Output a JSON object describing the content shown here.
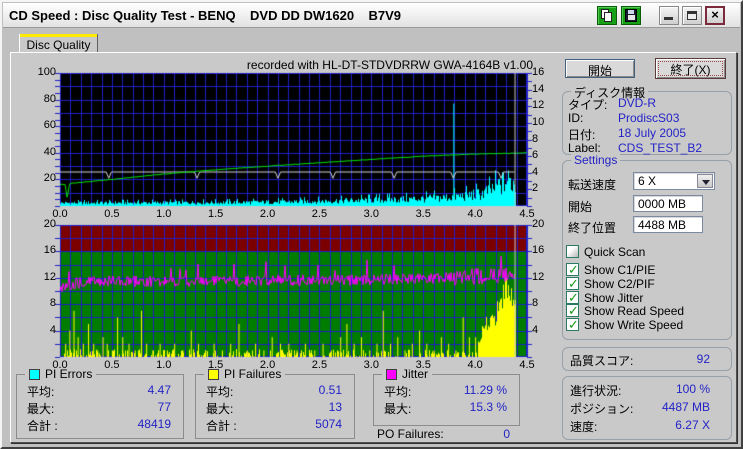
{
  "window": {
    "title": "CD Speed : Disc Quality Test - BENQ    DVD DD DW1620    B7V9"
  },
  "tab": {
    "label": "Disc Quality"
  },
  "buttons": {
    "start": "開始",
    "stop": "終了(X)"
  },
  "disc_info": {
    "group_label": "ディスク情報",
    "rows": [
      {
        "label": "タイプ:",
        "value": "DVD-R"
      },
      {
        "label": "ID:",
        "value": "ProdiscS03"
      },
      {
        "label": "日付:",
        "value": "18 July 2005"
      },
      {
        "label": "Label:",
        "value": "CDS_TEST_B2"
      }
    ]
  },
  "settings": {
    "group_label": "Settings",
    "speed_label": "転送速度",
    "speed_value": "6 X",
    "start_label": "開始",
    "start_value": "0000 MB",
    "end_label": "終了位置",
    "end_value": "4488 MB",
    "checkboxes": [
      {
        "label": "Quick Scan",
        "checked": false
      },
      {
        "label": "Show C1/PIE",
        "checked": true
      },
      {
        "label": "Show C2/PIF",
        "checked": true
      },
      {
        "label": "Show Jitter",
        "checked": true
      },
      {
        "label": "Show Read Speed",
        "checked": true
      },
      {
        "label": "Show Write Speed",
        "checked": true
      }
    ]
  },
  "quality": {
    "label": "品質スコア:",
    "value": "92"
  },
  "progress": {
    "rows": [
      {
        "label": "進行状況:",
        "value": "100 %"
      },
      {
        "label": "ポジション:",
        "value": "4487 MB"
      },
      {
        "label": "速度:",
        "value": "6.27 X"
      }
    ]
  },
  "stats": {
    "pi_errors": {
      "title": "PI Errors",
      "swatch": "#00ffff",
      "rows": [
        {
          "label": "平均:",
          "value": "4.47"
        },
        {
          "label": "最大:",
          "value": "77"
        },
        {
          "label": "合計 :",
          "value": "48419"
        }
      ]
    },
    "pi_failures": {
      "title": "PI Failures",
      "swatch": "#ffff00",
      "rows": [
        {
          "label": "平均:",
          "value": "0.51"
        },
        {
          "label": "最大:",
          "value": "13"
        },
        {
          "label": "合計 :",
          "value": "5074"
        }
      ]
    },
    "jitter": {
      "title": "Jitter",
      "swatch": "#ff00ff",
      "rows": [
        {
          "label": "平均:",
          "value": "11.29 %"
        },
        {
          "label": "最大:",
          "value": "15.3 %"
        }
      ]
    },
    "po_failures": {
      "label": "PO Failures:",
      "value": "0"
    }
  },
  "chart_data": [
    {
      "type": "area",
      "title": "recorded with HL-DT-STDVDRRW GWA-4164B v1.00",
      "x_range": [
        0,
        4.5
      ],
      "x_labels": [
        "0.0",
        "0.5",
        "1.0",
        "1.5",
        "2.0",
        "2.5",
        "3.0",
        "3.5",
        "4.0",
        "4.5"
      ],
      "y_left": {
        "range": [
          0,
          100
        ],
        "ticks": [
          100,
          80,
          60,
          40,
          20
        ],
        "grid_step": 10,
        "tick_step": 5
      },
      "y_right": {
        "range": [
          0,
          16
        ],
        "ticks": [
          16,
          14,
          12,
          10,
          8,
          6,
          4,
          2
        ],
        "tick_step": 1
      },
      "grid_x_step": 0.1,
      "background": "#000000",
      "grid_color": "#1f1fc8",
      "data_end_x": 4.38,
      "series": [
        {
          "name": "PI Errors",
          "type": "noise-bars",
          "axis": "left",
          "color": "#00ffff",
          "envelope_x": [
            0,
            0.3,
            0.8,
            1.3,
            1.8,
            2.2,
            2.6,
            3.0,
            3.4,
            3.7,
            3.9,
            4.05,
            4.15,
            4.25,
            4.32,
            4.38
          ],
          "envelope_y": [
            3.2,
            3.4,
            3.5,
            3.7,
            4.0,
            4.5,
            5.5,
            6.5,
            7.5,
            9,
            11,
            13,
            17,
            24,
            27,
            24
          ],
          "spike": {
            "x": 3.79,
            "y": 77
          },
          "stats": {
            "average": 4.47,
            "maximum": 77,
            "total": 48419
          }
        },
        {
          "name": "Write Speed",
          "type": "dip-line",
          "axis": "right",
          "color": "#d2d2d2",
          "base": 4.15,
          "dip_depth": 3.4,
          "x_end": 4.38,
          "dips_x": [
            0.47,
            1.32,
            2.1,
            2.63,
            3.22,
            3.79,
            4.25
          ]
        },
        {
          "name": "Read Speed",
          "type": "line",
          "axis": "right",
          "color": "#00e400",
          "x": [
            0,
            0.05,
            0.07,
            0.09,
            0.5,
            1.0,
            1.5,
            2.0,
            2.5,
            3.0,
            3.5,
            4.0,
            4.38,
            4.5
          ],
          "y": [
            2.6,
            2.62,
            0.8,
            2.7,
            3.2,
            3.85,
            4.35,
            4.8,
            5.2,
            5.6,
            6.0,
            6.25,
            6.35,
            6.42
          ]
        }
      ]
    },
    {
      "type": "area",
      "x_range": [
        0,
        4.5
      ],
      "x_labels": [
        "0.0",
        "0.5",
        "1.0",
        "1.5",
        "2.0",
        "2.5",
        "3.0",
        "3.5",
        "4.0",
        "4.5"
      ],
      "y_left": {
        "range": [
          0,
          20
        ],
        "ticks": [
          20,
          16,
          12,
          8,
          4
        ],
        "grid_step": 2,
        "tick_step": 2
      },
      "y_right": {
        "range": [
          0,
          20
        ],
        "ticks": [
          20,
          16,
          12,
          8,
          4
        ],
        "tick_step": 2
      },
      "grid_x_step": 0.1,
      "background": "#007c00",
      "danger_zone": {
        "from": 16,
        "to": 20,
        "color": "#7c0000"
      },
      "grid_color": "#1f1fc8",
      "data_end_x": 4.38,
      "series": [
        {
          "name": "PI Failures",
          "type": "spike-bars",
          "axis": "left",
          "color": "#ffff00",
          "spikes": [
            [
              0.05,
              2
            ],
            [
              0.09,
              4
            ],
            [
              0.13,
              7
            ],
            [
              0.17,
              3
            ],
            [
              0.22,
              2
            ],
            [
              0.27,
              5
            ],
            [
              0.32,
              2
            ],
            [
              0.36,
              1
            ],
            [
              0.41,
              3
            ],
            [
              0.45,
              2
            ],
            [
              0.5,
              1
            ],
            [
              0.55,
              6
            ],
            [
              0.6,
              3
            ],
            [
              0.66,
              2
            ],
            [
              0.72,
              1
            ],
            [
              0.78,
              7
            ],
            [
              0.83,
              2
            ],
            [
              0.89,
              1
            ],
            [
              0.96,
              2
            ],
            [
              1.03,
              1
            ],
            [
              1.1,
              2
            ],
            [
              1.18,
              1
            ],
            [
              1.26,
              4
            ],
            [
              1.33,
              2
            ],
            [
              1.4,
              1
            ],
            [
              1.48,
              2
            ],
            [
              1.56,
              1
            ],
            [
              1.64,
              2
            ],
            [
              1.72,
              5
            ],
            [
              1.8,
              1
            ],
            [
              1.88,
              2
            ],
            [
              1.96,
              1
            ],
            [
              2.04,
              3
            ],
            [
              2.12,
              2
            ],
            [
              2.2,
              2
            ],
            [
              2.28,
              1
            ],
            [
              2.36,
              2
            ],
            [
              2.45,
              1
            ],
            [
              2.53,
              2
            ],
            [
              2.61,
              1
            ],
            [
              2.7,
              3
            ],
            [
              2.76,
              5
            ],
            [
              2.83,
              2
            ],
            [
              2.9,
              3
            ],
            [
              2.98,
              1
            ],
            [
              3.05,
              2
            ],
            [
              3.11,
              7
            ],
            [
              3.18,
              2
            ],
            [
              3.25,
              3
            ],
            [
              3.32,
              1
            ],
            [
              3.39,
              2
            ],
            [
              3.46,
              4
            ],
            [
              3.53,
              2
            ],
            [
              3.6,
              1
            ],
            [
              3.67,
              3
            ],
            [
              3.74,
              2
            ],
            [
              3.81,
              1
            ],
            [
              3.88,
              6
            ],
            [
              3.94,
              3
            ],
            [
              4.0,
              3
            ]
          ],
          "ramp_x": [
            4.02,
            4.1,
            4.18,
            4.24,
            4.3,
            4.34,
            4.38
          ],
          "ramp_y": [
            3,
            6,
            8,
            10,
            13,
            12,
            9
          ],
          "stats": {
            "average": 0.51,
            "maximum": 13,
            "total": 5074
          }
        },
        {
          "name": "Jitter",
          "type": "noise-line",
          "axis": "left",
          "color": "#ff00ff",
          "envelope_x": [
            0,
            0.1,
            0.3,
            1.0,
            2.0,
            3.0,
            3.6,
            3.9,
            4.1,
            4.38
          ],
          "envelope_y": [
            10.2,
            11.0,
            11.5,
            11.4,
            11.6,
            11.7,
            11.9,
            12.2,
            12.3,
            12.5
          ],
          "noise": 0.85,
          "stats": {
            "average_pct": 11.29,
            "maximum_pct": 15.3
          }
        }
      ]
    }
  ]
}
